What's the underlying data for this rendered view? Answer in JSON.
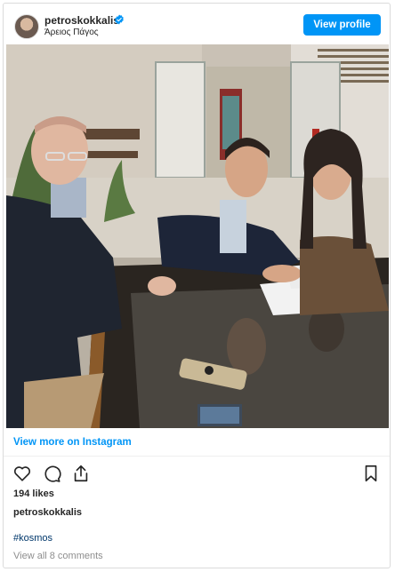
{
  "post": {
    "username": "petroskokkalis",
    "location": "Άρειος Πάγος",
    "view_profile_label": "View profile",
    "view_more_label": "View more on Instagram",
    "likes": "194 likes",
    "caption_username": "petroskokkalis",
    "hashtag": "#kosmos",
    "view_comments_label": "View all 8 comments"
  },
  "icons": {
    "verified": "verified-badge-icon",
    "like": "heart-icon",
    "comment": "comment-icon",
    "share": "share-icon",
    "save": "bookmark-icon"
  },
  "colors": {
    "accent": "#0095f6",
    "text": "#262626",
    "muted": "#8e8e8e",
    "hashtag": "#00376b",
    "border": "#dbdbdb"
  }
}
